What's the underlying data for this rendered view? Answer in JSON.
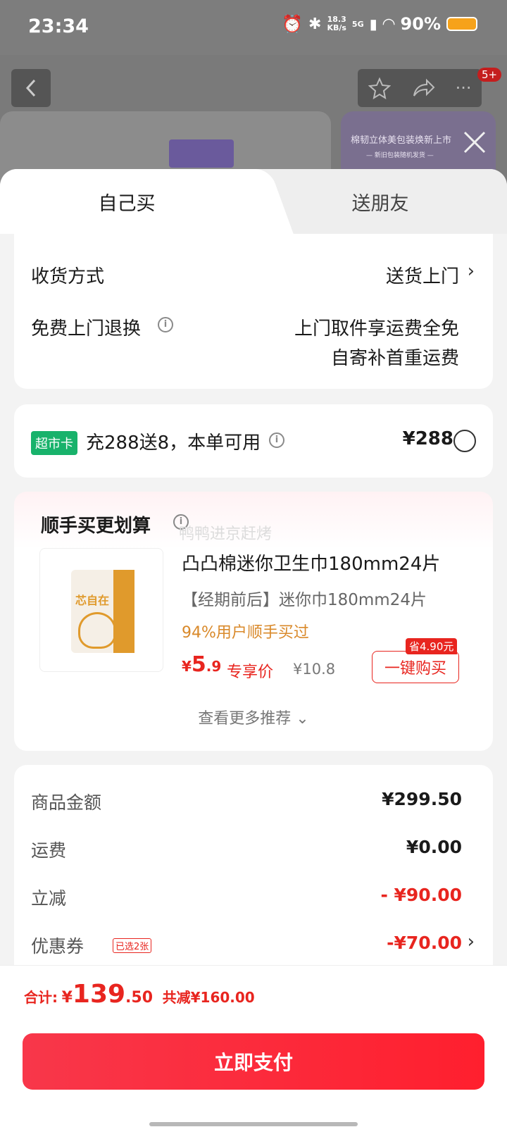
{
  "status_bar": {
    "time": "23:34",
    "net_speed": "18.3",
    "net_unit": "KB/s",
    "network": "5G",
    "battery": "90%"
  },
  "background": {
    "notification_count": "5+",
    "banner_text": "棉韧立体美包装焕新上市",
    "banner_sub": "— 新旧包装随机发货 —"
  },
  "tabs": [
    {
      "label": "自己买",
      "active": true
    },
    {
      "label": "送朋友",
      "active": false
    }
  ],
  "delivery": {
    "method_label": "收货方式",
    "method_value": "送货上门",
    "return_label": "免费上门退换",
    "return_line1": "上门取件享运费全免",
    "return_line2": "自寄补首重运费"
  },
  "supermarket_card": {
    "tag": "超市卡",
    "text": "充288送8，本单可用",
    "price": "¥288"
  },
  "recommendation": {
    "title": "顺手买更划算",
    "watermark": "鸭鸭进京赶烤",
    "product_name": "凸凸棉迷你卫生巾180mm24片",
    "product_sub": "【经期前后】迷你巾180mm24片",
    "stat": "94%用户顺手买过",
    "price_symbol": "¥",
    "price_int": "5",
    "price_dec": ".9",
    "price_label": "专享价",
    "orig_price": "¥10.8",
    "save_tag": "省4.90元",
    "buy_label": "一键购买",
    "more_label": "查看更多推荐",
    "pack_text": "芯自在"
  },
  "fees": {
    "goods_label": "商品金额",
    "goods_value": "¥299.50",
    "shipping_label": "运费",
    "shipping_value": "¥0.00",
    "discount_label": "立减",
    "discount_value": "- ¥90.00",
    "coupon_label": "优惠券",
    "coupon_tag": "已选2张",
    "coupon_value": "-¥70.00"
  },
  "footer": {
    "total_label": "合计:",
    "total_symbol": "¥",
    "total_int": "139",
    "total_dec": ".50",
    "total_saved": "共减¥160.00",
    "pay_label": "立即支付"
  },
  "colors": {
    "accent_red": "#e8251f",
    "green_tag": "#18b26b",
    "orange_stat": "#d9892a"
  }
}
